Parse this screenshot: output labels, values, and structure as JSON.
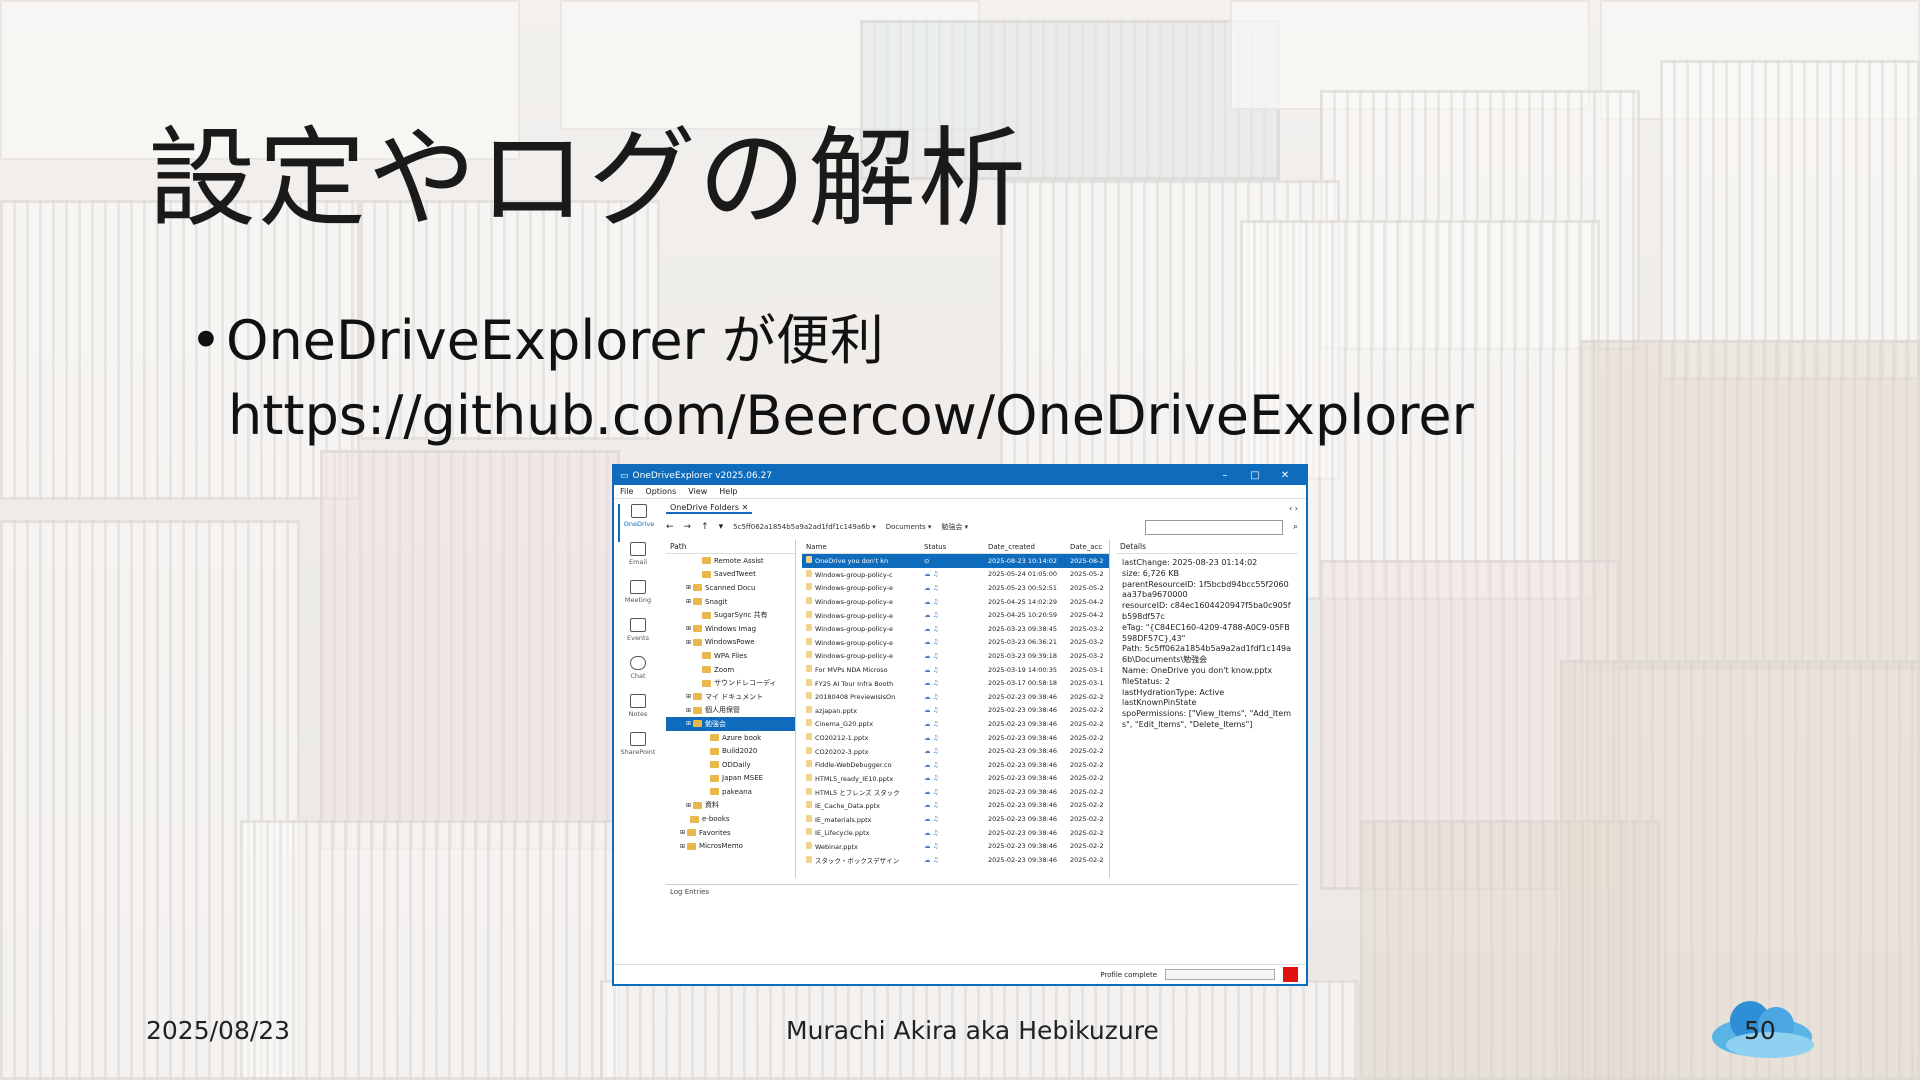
{
  "slide": {
    "title": "設定やログの解析",
    "bullet": "OneDriveExplorer が便利",
    "url": "https://github.com/Beercow/OneDriveExplorer",
    "footer_date": "2025/08/23",
    "footer_author": "Murachi Akira aka Hebikuzure",
    "page_number": "50"
  },
  "window": {
    "title": "OneDriveExplorer v2025.06.27",
    "controls": {
      "minimize": "–",
      "maximize": "□",
      "close": "✕"
    },
    "menu": [
      "File",
      "Options",
      "View",
      "Help"
    ],
    "nav": [
      "OneDrive",
      "Email",
      "Meeting",
      "Events",
      "Chat",
      "Notes",
      "SharePoint"
    ],
    "tab_label": "OneDrive Folders",
    "tab_close": "✕",
    "tab_scroll": "‹ ›",
    "toolbar": {
      "back": "←",
      "forward": "→",
      "up": "↑",
      "history": "▾",
      "crumb_id": "5c5ff062a1854b5a9a2ad1fdf1c149a6b ▾",
      "crumb_docs": "Documents ▾",
      "crumb_study": "勉強会 ▾",
      "search_icon": "⌕"
    },
    "tree_header": "Path",
    "tree": [
      "Remote Assist",
      "SavedTweet",
      "Scanned Docu",
      "Snagit",
      "SugarSync 共有",
      "Windows Imag",
      "WindowsPowe",
      "WPA Files",
      "Zoom",
      "サウンドレコーディ",
      "マイ ドキュメント",
      "個人用保管",
      "勉強会",
      "Azure book",
      "Build2020",
      "ODDaily",
      "Japan MSEE",
      "pakeana",
      "資料",
      "e-books",
      "Favorites",
      "MicrosMemo"
    ],
    "table_headers": {
      "name": "Name",
      "status": "Status",
      "created": "Date_created",
      "accessed": "Date_acc"
    },
    "files": [
      {
        "name": "OneDrive you don't kn",
        "status": "⊙",
        "created": "2025-08-23 10:14:02",
        "accessed": "2025-08-2"
      },
      {
        "name": "Windows-group-policy-c",
        "status": "☁ ♫",
        "created": "2025-05-24 01:05:00",
        "accessed": "2025-05-2"
      },
      {
        "name": "Windows-group-policy-e",
        "status": "☁ ♫",
        "created": "2025-05-23 00:52:51",
        "accessed": "2025-05-2"
      },
      {
        "name": "Windows-group-policy-e",
        "status": "☁ ♫",
        "created": "2025-04-25 14:02:29",
        "accessed": "2025-04-2"
      },
      {
        "name": "Windows-group-policy-e",
        "status": "☁ ♫",
        "created": "2025-04-25 10:20:59",
        "accessed": "2025-04-2"
      },
      {
        "name": "Windows-group-policy-e",
        "status": "☁ ♫",
        "created": "2025-03-23 09:38:45",
        "accessed": "2025-03-2"
      },
      {
        "name": "Windows-group-policy-e",
        "status": "☁ ♫",
        "created": "2025-03-23 06:36:21",
        "accessed": "2025-03-2"
      },
      {
        "name": "Windows-group-policy-e",
        "status": "☁ ♫",
        "created": "2025-03-23 09:39:18",
        "accessed": "2025-03-2"
      },
      {
        "name": "For MVPs NDA Microso",
        "status": "☁ ♫",
        "created": "2025-03-19 14:00:35",
        "accessed": "2025-03-1"
      },
      {
        "name": "FY25 AI Tour Infra Booth",
        "status": "☁ ♫",
        "created": "2025-03-17 00:58:18",
        "accessed": "2025-03-1"
      },
      {
        "name": "20180408 PreviewIsIsOn",
        "status": "☁ ♫",
        "created": "2025-02-23 09:38:46",
        "accessed": "2025-02-2"
      },
      {
        "name": "azjapan.pptx",
        "status": "☁ ♫",
        "created": "2025-02-23 09:38:46",
        "accessed": "2025-02-2"
      },
      {
        "name": "Cinema_G20.pptx",
        "status": "☁ ♫",
        "created": "2025-02-23 09:38:46",
        "accessed": "2025-02-2"
      },
      {
        "name": "CO20212-1.pptx",
        "status": "☁ ♫",
        "created": "2025-02-23 09:38:46",
        "accessed": "2025-02-2"
      },
      {
        "name": "CO20202-3.pptx",
        "status": "☁ ♫",
        "created": "2025-02-23 09:38:46",
        "accessed": "2025-02-2"
      },
      {
        "name": "Fiddle-WebDebugger.co",
        "status": "☁ ♫",
        "created": "2025-02-23 09:38:46",
        "accessed": "2025-02-2"
      },
      {
        "name": "HTML5_ready_IE10.pptx",
        "status": "☁ ♫",
        "created": "2025-02-23 09:38:46",
        "accessed": "2025-02-2"
      },
      {
        "name": "HTML5 とフレンズ スタック",
        "status": "☁ ♫",
        "created": "2025-02-23 09:38:46",
        "accessed": "2025-02-2"
      },
      {
        "name": "IE_Cache_Data.pptx",
        "status": "☁ ♫",
        "created": "2025-02-23 09:38:46",
        "accessed": "2025-02-2"
      },
      {
        "name": "IE_materials.pptx",
        "status": "☁ ♫",
        "created": "2025-02-23 09:38:46",
        "accessed": "2025-02-2"
      },
      {
        "name": "IE_Lifecycle.pptx",
        "status": "☁ ♫",
        "created": "2025-02-23 09:38:46",
        "accessed": "2025-02-2"
      },
      {
        "name": "Webinar.pptx",
        "status": "☁ ♫",
        "created": "2025-02-23 09:38:46",
        "accessed": "2025-02-2"
      },
      {
        "name": "スタック・ボックスデザイン",
        "status": "☁ ♫",
        "created": "2025-02-23 09:38:46",
        "accessed": "2025-02-2"
      }
    ],
    "details_header": "Details",
    "details": [
      "lastChange: 2025-08-23 01:14:02",
      "size: 6,726 KB",
      "parentResourceID: 1f5bcbd94bcc55f2060aa37ba9670000",
      "resourceID: c84ec1604420947f5ba0c905fb598df57c",
      "eTag: \"{C84EC160-4209-4788-A0C9-05FB598DF57C},43\"",
      "Path: 5c5ff062a1854b5a9a2ad1fdf1c149a6b\\Documents\\勉強会",
      "Name: OneDrive you don't know.pptx",
      "fileStatus: 2",
      "lastHydrationType: Active",
      "lastKnownPinState",
      "spoPermissions: [\"View_Items\", \"Add_Items\", \"Edit_Items\", \"Delete_Items\"]"
    ],
    "log_label": "Log Entries",
    "status_text": "Profile complete"
  }
}
